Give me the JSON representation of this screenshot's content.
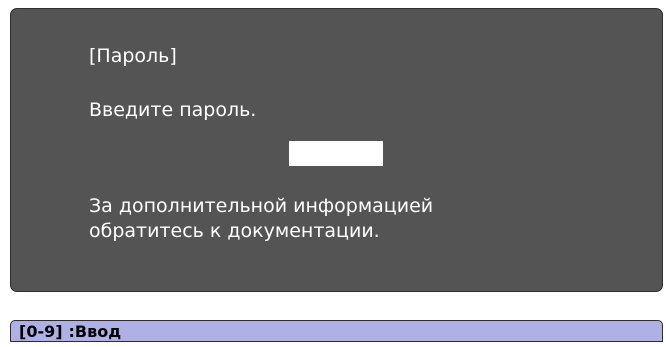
{
  "dialog": {
    "title": "[Пароль]",
    "prompt": "Введите пароль.",
    "password_value": "",
    "info_line1": "За дополнительной информацией",
    "info_line2": "обратитесь к документации."
  },
  "statusbar": {
    "key_hint": "[0-9]",
    "action": ":Ввод"
  },
  "colors": {
    "dialog_background": "#545454",
    "statusbar_background": "#aeb0e6",
    "text": "#ffffff"
  }
}
